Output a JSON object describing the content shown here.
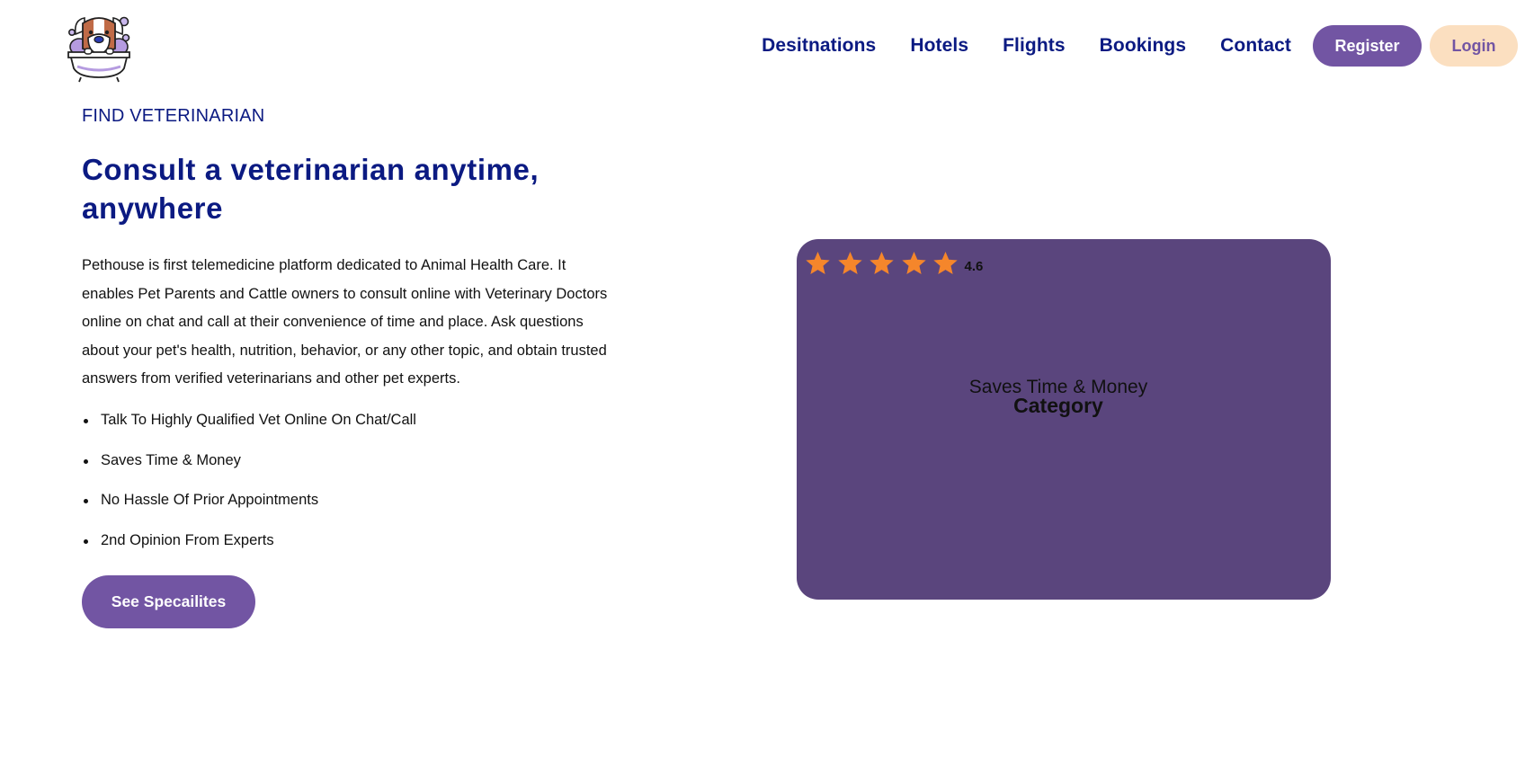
{
  "header": {
    "logo_icon": "dog-in-bathtub-logo",
    "nav_links": [
      "Desitnations",
      "Hotels",
      "Flights",
      "Bookings",
      "Contact"
    ],
    "register_label": "Register",
    "login_label": "Login"
  },
  "hero": {
    "eyebrow": "FIND VETERINARIAN",
    "headline": "Consult a veterinarian anytime, anywhere",
    "description": "Pethouse is first telemedicine platform dedicated to Animal Health Care. It enables Pet Parents and Cattle owners to consult online with Veterinary Doctors online on chat and call at their convenience of time and place. Ask questions about your pet's health, nutrition, behavior, or any other topic, and obtain trusted answers from verified veterinarians and other pet experts.",
    "features": [
      "Talk To Highly Qualified Vet Online On Chat/Call",
      "Saves Time & Money",
      "No Hassle Of Prior Appointments",
      "2nd Opinion From Experts"
    ],
    "cta_label": "See Specailites"
  },
  "card": {
    "stars": 5,
    "star_icon": "star-icon",
    "rating": "4.6",
    "subtitle": "Saves Time & Money",
    "title": "Category"
  },
  "colors": {
    "navy": "#0b1a82",
    "purple": "#7255a3",
    "card_bg": "#5a457d",
    "login_bg": "#fbdfc0",
    "star": "#f5862b"
  }
}
